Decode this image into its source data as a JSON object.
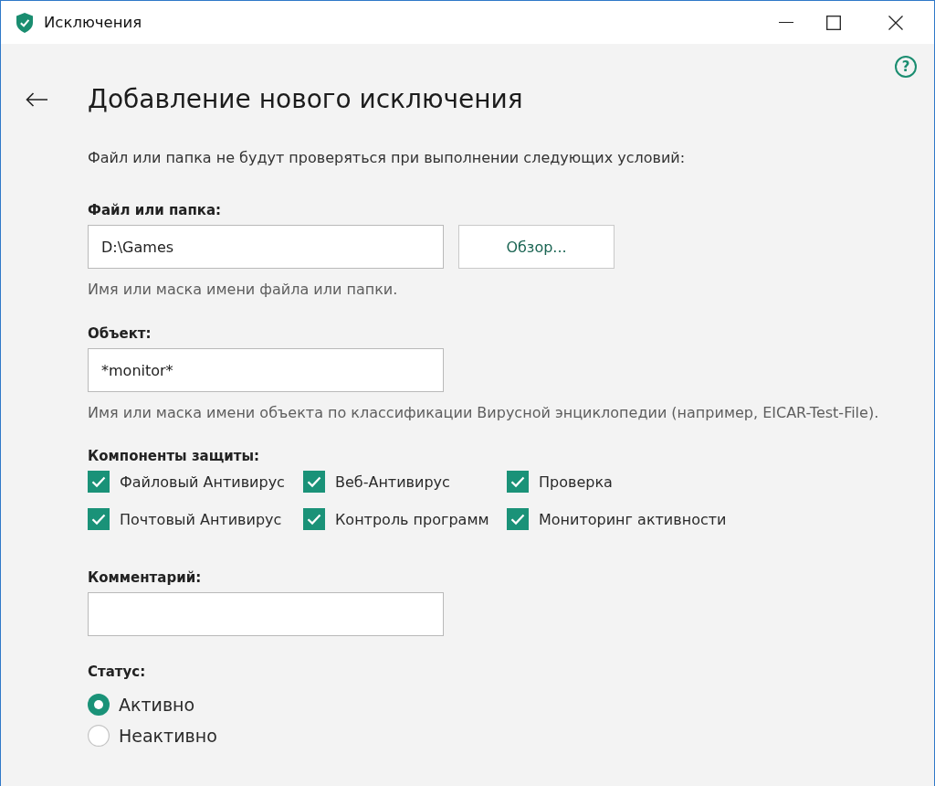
{
  "window": {
    "title": "Исключения"
  },
  "header": {
    "help": "?",
    "title": "Добавление нового исключения"
  },
  "description": "Файл или папка не будут проверяться при выполнении следующих условий:",
  "file_field": {
    "label": "Файл или папка:",
    "value": "D:\\Games",
    "browse_button": "Обзор...",
    "hint": "Имя или маска имени файла или папки."
  },
  "object_field": {
    "label": "Объект:",
    "value": "*monitor*",
    "hint": "Имя или маска имени объекта по классификации Вирусной энциклопедии (например, EICAR-Test-File)."
  },
  "components": {
    "label": "Компоненты защиты:",
    "items": [
      {
        "label": "Файловый Антивирус",
        "checked": true
      },
      {
        "label": "Веб-Антивирус",
        "checked": true
      },
      {
        "label": "Проверка",
        "checked": true
      },
      {
        "label": "Почтовый Антивирус",
        "checked": true
      },
      {
        "label": "Контроль программ",
        "checked": true
      },
      {
        "label": "Мониторинг активности",
        "checked": true
      }
    ]
  },
  "comment_field": {
    "label": "Комментарий:"
  },
  "status": {
    "label": "Статус:",
    "options": [
      {
        "label": "Активно",
        "selected": true
      },
      {
        "label": "Неактивно",
        "selected": false
      }
    ]
  }
}
